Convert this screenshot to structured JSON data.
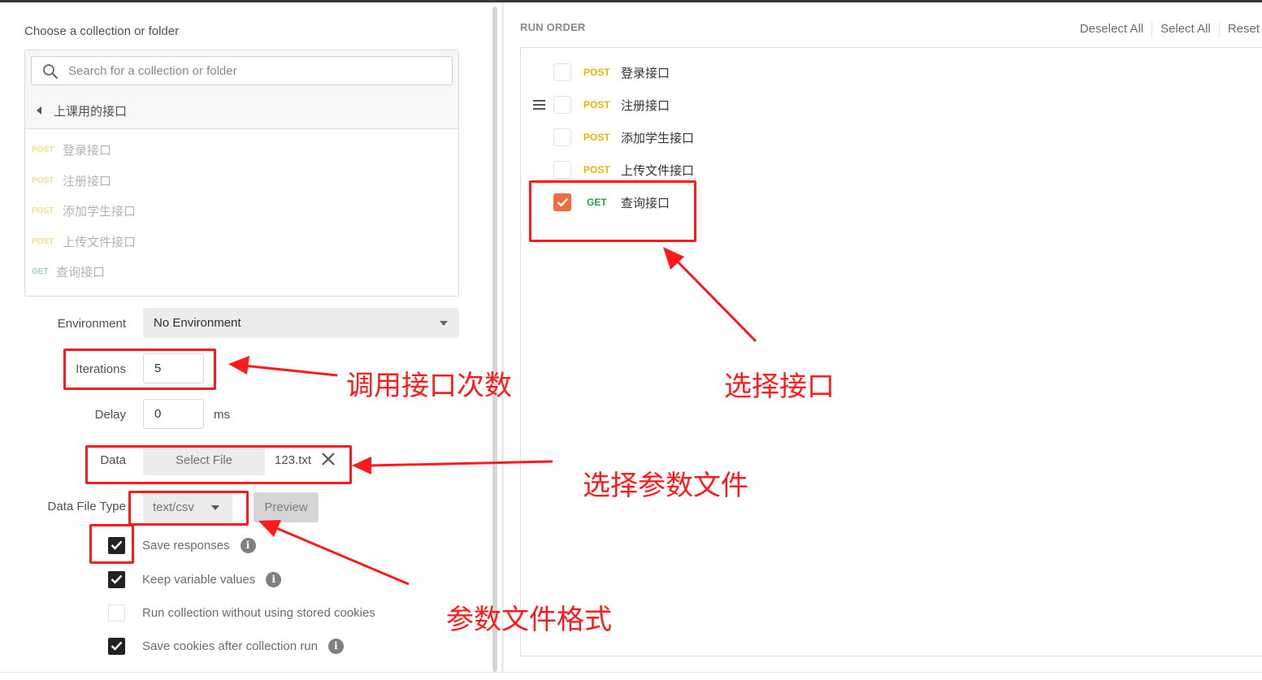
{
  "left_panel": {
    "choose_label": "Choose a collection or folder",
    "search_placeholder": "Search for a collection or folder",
    "folder_name": "上课用的接口",
    "requests": [
      {
        "method": "POST",
        "name": "登录接口"
      },
      {
        "method": "POST",
        "name": "注册接口"
      },
      {
        "method": "POST",
        "name": "添加学生接口"
      },
      {
        "method": "POST",
        "name": "上传文件接口"
      },
      {
        "method": "GET",
        "name": "查询接口"
      }
    ]
  },
  "settings": {
    "environment_label": "Environment",
    "environment_value": "No Environment",
    "iterations_label": "Iterations",
    "iterations_value": "5",
    "delay_label": "Delay",
    "delay_value": "0",
    "delay_unit": "ms",
    "data_label": "Data",
    "select_file_label": "Select File",
    "file_name": "123.txt",
    "data_file_type_label": "Data File Type",
    "data_file_type_value": "text/csv",
    "preview_label": "Preview",
    "options": [
      {
        "label": "Save responses",
        "checked": true,
        "info": true
      },
      {
        "label": "Keep variable values",
        "checked": true,
        "info": true
      },
      {
        "label": "Run collection without using stored cookies",
        "checked": false,
        "info": false
      },
      {
        "label": "Save cookies after collection run",
        "checked": true,
        "info": true
      }
    ]
  },
  "run_order": {
    "title": "RUN ORDER",
    "deselect_all": "Deselect All",
    "select_all": "Select All",
    "reset": "Reset",
    "items": [
      {
        "method": "POST",
        "name": "登录接口",
        "checked": false
      },
      {
        "method": "POST",
        "name": "注册接口",
        "checked": false
      },
      {
        "method": "POST",
        "name": "添加学生接口",
        "checked": false
      },
      {
        "method": "POST",
        "name": "上传文件接口",
        "checked": false
      },
      {
        "method": "GET",
        "name": "查询接口",
        "checked": true
      }
    ]
  },
  "annotations": {
    "iterations_note": "调用接口次数",
    "select_api_note": "选择接口",
    "data_file_note": "选择参数文件",
    "file_format_note": "参数文件格式"
  },
  "colors": {
    "annotation_red": "#ff1a1a",
    "post_method": "#f0b400",
    "get_method": "#2e9e48",
    "checked_orange": "#f26b3a"
  }
}
